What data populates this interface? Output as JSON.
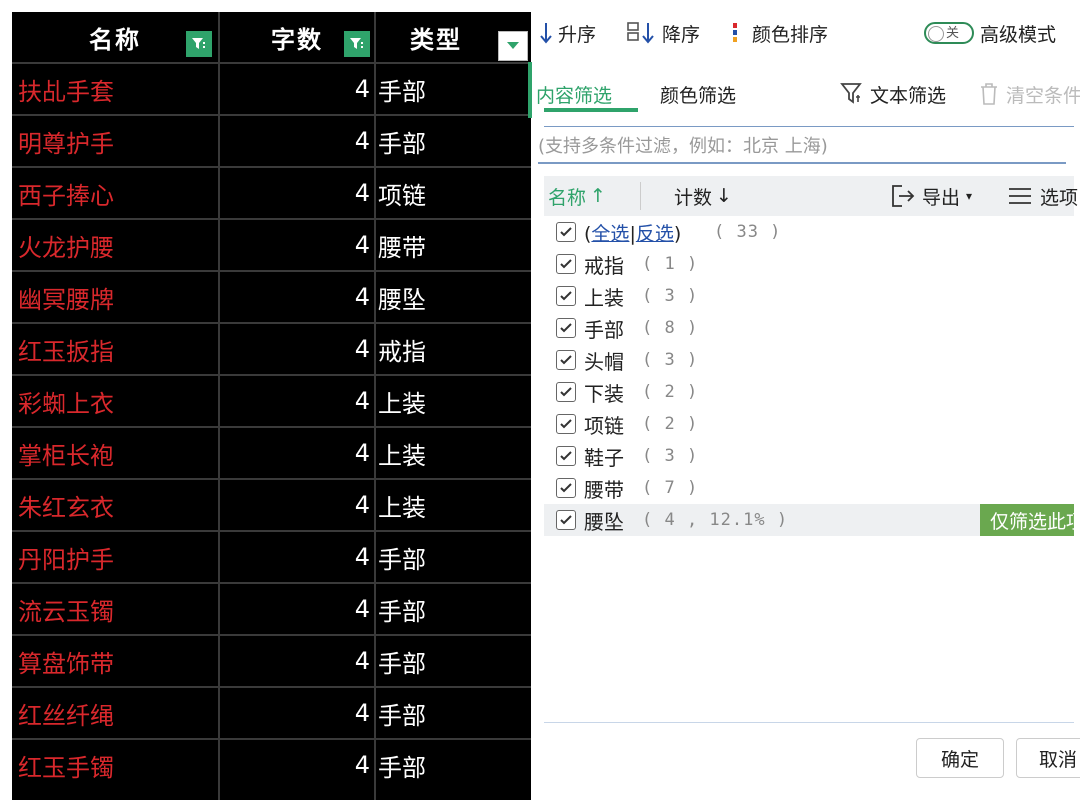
{
  "sheet": {
    "headers": {
      "name": "名称",
      "count": "字数",
      "type": "类型"
    },
    "rows": [
      {
        "name": "扶乩手套",
        "count": "4",
        "type": "手部"
      },
      {
        "name": "明尊护手",
        "count": "4",
        "type": "手部"
      },
      {
        "name": "西子捧心",
        "count": "4",
        "type": "项链"
      },
      {
        "name": "火龙护腰",
        "count": "4",
        "type": "腰带"
      },
      {
        "name": "幽冥腰牌",
        "count": "4",
        "type": "腰坠"
      },
      {
        "name": "红玉扳指",
        "count": "4",
        "type": "戒指"
      },
      {
        "name": "彩蜘上衣",
        "count": "4",
        "type": "上装"
      },
      {
        "name": "掌柜长袍",
        "count": "4",
        "type": "上装"
      },
      {
        "name": "朱红玄衣",
        "count": "4",
        "type": "上装"
      },
      {
        "name": "丹阳护手",
        "count": "4",
        "type": "手部"
      },
      {
        "name": "流云玉镯",
        "count": "4",
        "type": "手部"
      },
      {
        "name": "算盘饰带",
        "count": "4",
        "type": "手部"
      },
      {
        "name": "红丝纤绳",
        "count": "4",
        "type": "手部"
      },
      {
        "name": "红玉手镯",
        "count": "4",
        "type": "手部"
      }
    ]
  },
  "toolbar": {
    "asc": "升序",
    "desc": "降序",
    "color_sort": "颜色排序",
    "toggle_state": "关",
    "advanced": "高级模式"
  },
  "tabs": {
    "content": "内容筛选",
    "color": "颜色筛选",
    "text_filter": "文本筛选",
    "clear": "清空条件"
  },
  "search": {
    "placeholder": "(支持多条件过滤，例如：北京 上海)"
  },
  "list_header": {
    "name": "名称",
    "count": "计数",
    "export": "导出",
    "options": "选项"
  },
  "select_all": {
    "all": "全选",
    "sep": "|",
    "invert": "反选",
    "count": "( 33 )"
  },
  "items": [
    {
      "label": "戒指",
      "count": "( 1 )"
    },
    {
      "label": "上装",
      "count": "( 3 )"
    },
    {
      "label": "手部",
      "count": "( 8 )"
    },
    {
      "label": "头帽",
      "count": "( 3 )"
    },
    {
      "label": "下装",
      "count": "( 2 )"
    },
    {
      "label": "项链",
      "count": "( 2 )"
    },
    {
      "label": "鞋子",
      "count": "( 3 )"
    },
    {
      "label": "腰带",
      "count": "( 7 )"
    },
    {
      "label": "腰坠",
      "count": "( 4 , 12.1% )"
    }
  ],
  "only_filter": "仅筛选此项",
  "buttons": {
    "ok": "确定",
    "cancel": "取消"
  },
  "colors": {
    "accent": "#2fa36b",
    "name_text": "#d9282c"
  }
}
